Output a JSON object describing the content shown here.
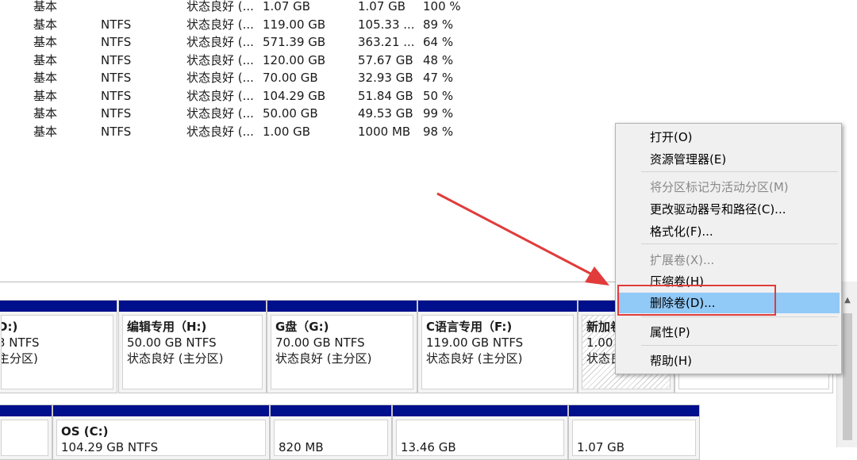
{
  "volumes": [
    {
      "type": "基本",
      "fs": "",
      "status": "状态良好 (...",
      "capacity": "1.07 GB",
      "free": "1.07 GB",
      "pct": "100 %"
    },
    {
      "type": "基本",
      "fs": "NTFS",
      "status": "状态良好 (...",
      "capacity": "119.00 GB",
      "free": "105.33 ...",
      "pct": "89 %"
    },
    {
      "type": "基本",
      "fs": "NTFS",
      "status": "状态良好 (...",
      "capacity": "571.39 GB",
      "free": "363.21 ...",
      "pct": "64 %"
    },
    {
      "type": "基本",
      "fs": "NTFS",
      "status": "状态良好 (...",
      "capacity": "120.00 GB",
      "free": "57.67 GB",
      "pct": "48 %"
    },
    {
      "type": "基本",
      "fs": "NTFS",
      "status": "状态良好 (...",
      "capacity": "70.00 GB",
      "free": "32.93 GB",
      "pct": "47 %"
    },
    {
      "type": "基本",
      "fs": "NTFS",
      "status": "状态良好 (...",
      "capacity": "104.29 GB",
      "free": "51.84 GB",
      "pct": "50 %"
    },
    {
      "type": "基本",
      "fs": "NTFS",
      "status": "状态良好 (...",
      "capacity": "50.00 GB",
      "free": "49.53 GB",
      "pct": "99 %"
    },
    {
      "type": "基本",
      "fs": "NTFS",
      "status": "状态良好 (...",
      "capacity": "1.00 GB",
      "free": "1000 MB",
      "pct": "98 %"
    }
  ],
  "disk1": [
    {
      "title": "D:)",
      "size": "3 NTFS",
      "status": "主分区)"
    },
    {
      "title": "编辑专用（H:)",
      "size": "50.00 GB NTFS",
      "status": "状态良好 (主分区)"
    },
    {
      "title": "G盘（G:)",
      "size": "70.00 GB NTFS",
      "status": "状态良好 (主分区)"
    },
    {
      "title": "C语言专用（F:)",
      "size": "119.00 GB NTFS",
      "status": "状态良好 (主分区)"
    },
    {
      "title": "新加卷",
      "size": "1.00",
      "status": "状态良"
    }
  ],
  "disk0": [
    {
      "title": "",
      "size": "",
      "status": ""
    },
    {
      "title": "OS  (C:)",
      "size": "104.29 GB NTFS",
      "status": ""
    },
    {
      "title": "",
      "size": "820 MB",
      "status": ""
    },
    {
      "title": "",
      "size": "13.46 GB",
      "status": ""
    },
    {
      "title": "",
      "size": "1.07 GB",
      "status": ""
    }
  ],
  "context_menu": {
    "open": "打开(O)",
    "explorer": "资源管理器(E)",
    "mark_active": "将分区标记为活动分区(M)",
    "change_letter": "更改驱动器号和路径(C)...",
    "format": "格式化(F)...",
    "extend": "扩展卷(X)...",
    "shrink": "压缩卷(H)",
    "delete": "删除卷(D)...",
    "properties": "属性(P)",
    "help": "帮助(H)"
  },
  "colors": {
    "partition_bar": "#000f8c",
    "menu_highlight": "#91c9f7",
    "annotation_red": "#e23b3b"
  }
}
